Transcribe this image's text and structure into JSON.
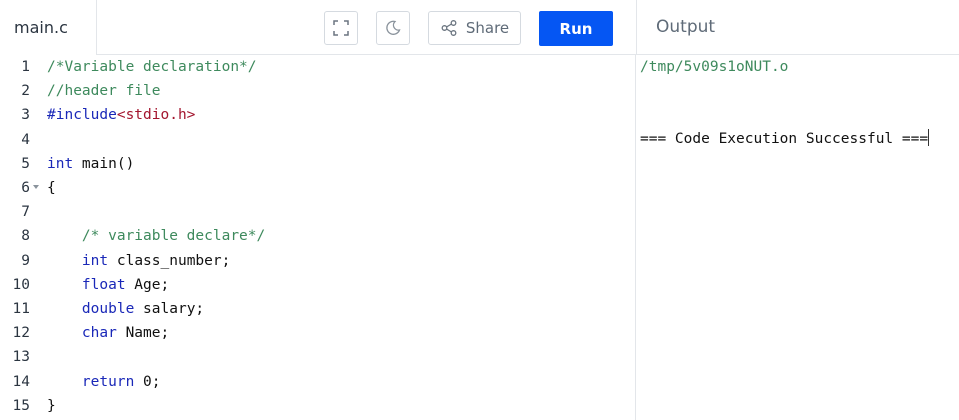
{
  "header": {
    "file_tab": "main.c",
    "share_label": "Share",
    "run_label": "Run",
    "output_title": "Output"
  },
  "editor": {
    "lines": [
      {
        "n": "1",
        "parts": [
          {
            "t": "/*Variable declaration*/",
            "c": "cm"
          }
        ]
      },
      {
        "n": "2",
        "parts": [
          {
            "t": "//header file",
            "c": "cm"
          }
        ]
      },
      {
        "n": "3",
        "parts": [
          {
            "t": "#include",
            "c": "kw"
          },
          {
            "t": "<stdio.h>",
            "c": "str"
          }
        ]
      },
      {
        "n": "4",
        "parts": []
      },
      {
        "n": "5",
        "parts": [
          {
            "t": "int",
            "c": "kw"
          },
          {
            "t": " main()",
            "c": ""
          }
        ]
      },
      {
        "n": "6",
        "fold": true,
        "parts": [
          {
            "t": "{",
            "c": ""
          }
        ]
      },
      {
        "n": "7",
        "parts": []
      },
      {
        "n": "8",
        "parts": [
          {
            "t": "    /* variable declare*/",
            "c": "cm"
          }
        ]
      },
      {
        "n": "9",
        "parts": [
          {
            "t": "    ",
            "c": ""
          },
          {
            "t": "int",
            "c": "kw"
          },
          {
            "t": " class_number;",
            "c": ""
          }
        ]
      },
      {
        "n": "10",
        "parts": [
          {
            "t": "    ",
            "c": ""
          },
          {
            "t": "float",
            "c": "kw"
          },
          {
            "t": " Age;",
            "c": ""
          }
        ]
      },
      {
        "n": "11",
        "parts": [
          {
            "t": "    ",
            "c": ""
          },
          {
            "t": "double",
            "c": "kw"
          },
          {
            "t": " salary;",
            "c": ""
          }
        ]
      },
      {
        "n": "12",
        "parts": [
          {
            "t": "    ",
            "c": ""
          },
          {
            "t": "char",
            "c": "kw"
          },
          {
            "t": " Name;",
            "c": ""
          }
        ]
      },
      {
        "n": "13",
        "parts": []
      },
      {
        "n": "14",
        "parts": [
          {
            "t": "    ",
            "c": ""
          },
          {
            "t": "return",
            "c": "kw"
          },
          {
            "t": " 0;",
            "c": ""
          }
        ]
      },
      {
        "n": "15",
        "parts": [
          {
            "t": "}",
            "c": ""
          }
        ]
      }
    ]
  },
  "output": {
    "path": "/tmp/5v09s1oNUT.o",
    "message": "=== Code Execution Successful ==="
  },
  "colors": {
    "run_button": "#0556f3",
    "comment": "#3e8a5d",
    "keyword": "#1a28b8",
    "string": "#a3152e",
    "output_path": "#3e8a5d"
  },
  "icons": [
    "fullscreen-icon",
    "moon-icon",
    "share-icon",
    "fold-arrow-icon"
  ]
}
